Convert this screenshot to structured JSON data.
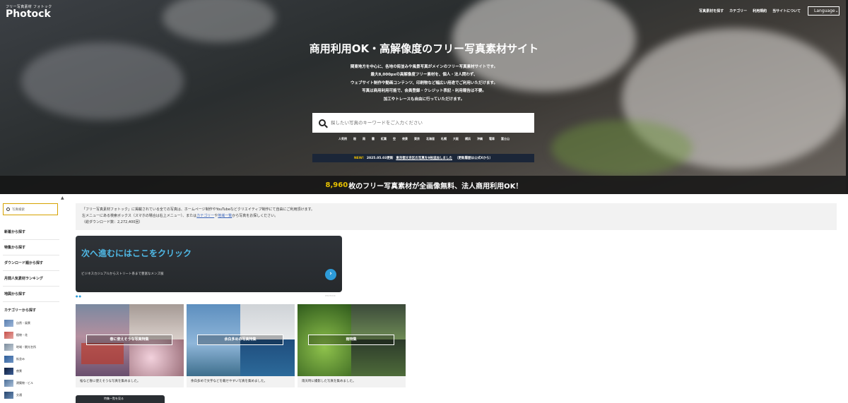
{
  "header": {
    "logo_small": "フリー写真素材 フォトック",
    "logo_big": "Photock",
    "nav": [
      "写真素材を探す",
      "カテゴリー",
      "利用規約",
      "当サイトについて"
    ],
    "language": "Language",
    "language_caret": "⌄"
  },
  "hero": {
    "title": "商用利用OK・高解像度のフリー写真素材サイト",
    "desc_lines": [
      "関東地方を中心に、各地の街並みや風景写真がメインのフリー写真素材サイトです。",
      "最大8,000pxの高解像度フリー素材を、個人・法人問わず、",
      "ウェブサイト制作や動画コンテンツ、印刷物など幅広い用途でご利用いただけます。",
      "写真は商用利用可能で、会員登録・クレジット表記・利用報告は不要。",
      "加工やトレースも自由に行っていただけます。"
    ],
    "search_placeholder": "探したい写真のキーワードをご入力ください",
    "tags_label": "人気例",
    "tags": [
      "桜",
      "雨",
      "雲",
      "紅葉",
      "空",
      "夜景",
      "東京",
      "北海道",
      "札幌",
      "大阪",
      "横浜",
      "沖縄",
      "電車",
      "富士山"
    ],
    "news_new": "NEW!",
    "news_date": "2025.05.03更新",
    "news_link": "東京都文京区の写真を9枚追加しました",
    "news_tail": "（更新履歴は公式Xから）",
    "banner_count": "8,960",
    "banner_text": "枚のフリー写真素材が全画像無料、法人商用利用OK！"
  },
  "sidebar": {
    "search_placeholder": "写真検索",
    "items": [
      "新着から探す",
      "特集から探す",
      "ダウンロード順から探す",
      "月間人気素材ランキング",
      "地図から探す",
      "カテゴリーから探す"
    ],
    "categories": [
      "自然・風景",
      "植物・花",
      "地域・観光名所",
      "街並み",
      "夜景",
      "建築物・ビル",
      "交通"
    ]
  },
  "main": {
    "info_line1": "「フリー写真素材フォトック」に掲載されている全ての写真は、ホームページ制作やYouTubeなどクリエイティブ制作にて自由にご利用頂けます。",
    "info_line2_a": "左メニューにある検索ボックス（スマホの場合は右上メニュー）、または",
    "info_link1": "カテゴリー",
    "info_mid": "や",
    "info_link2": "地域一覧",
    "info_line2_b": "から写真をお探しください。",
    "info_line3": "（総ダウンロード数：2,272,400回）",
    "feature_title": "次へ進むにはここをクリック",
    "feature_sub": "ビジネスカジュアルからストリート系まで豊富なメンズ服",
    "feature_next": "›",
    "dots": "●●",
    "dots_right": "PHOTOCK",
    "cards": [
      {
        "label": "春に使えそうな写真特集",
        "desc": "桜など春に使えそうな写真を集めました。"
      },
      {
        "label": "余白多めの写真特集",
        "desc": "余白多めで文字などを載せやすい写真を集めました。"
      },
      {
        "label": "雨特集",
        "desc": "雨天時に撮影した写真を集めました。"
      }
    ],
    "bottom_tab": "特集一覧を見る"
  },
  "colors": {
    "accent_blue": "#4fb9e6",
    "banner_yellow": "#e8c200",
    "news_bg": "#1b2638",
    "sidebar_search_border": "#d6a200"
  }
}
